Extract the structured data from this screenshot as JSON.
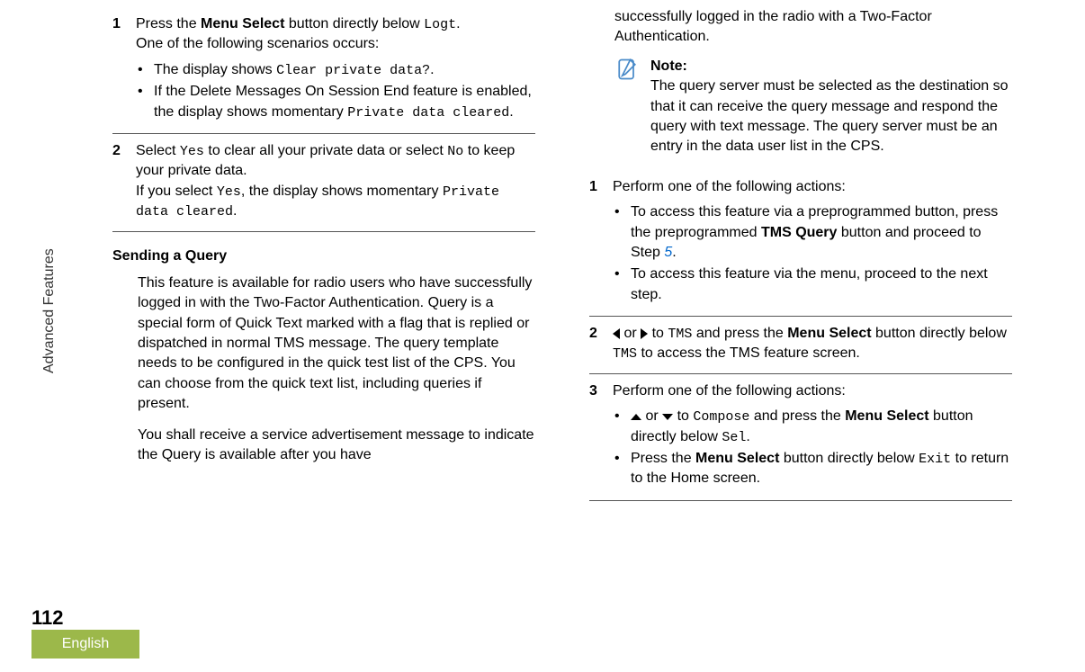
{
  "sideLabel": "Advanced Features",
  "pageNumber": "112",
  "language": "English",
  "leftColumn": {
    "step1": {
      "num": "1",
      "line1a": "Press the ",
      "line1b": "Menu Select",
      "line1c": " button directly below ",
      "line1d": "Logt",
      "line1e": ".",
      "line2": "One of the following scenarios occurs:",
      "bullet1a": "The display shows ",
      "bullet1b": "Clear private data?",
      "bullet1c": ".",
      "bullet2a": "If the Delete Messages On Session End feature is enabled, the display shows momentary ",
      "bullet2b": "Private data cleared",
      "bullet2c": "."
    },
    "step2": {
      "num": "2",
      "line1a": "Select ",
      "line1b": "Yes",
      "line1c": " to clear all your private data or select ",
      "line1d": "No",
      "line1e": " to keep your private data.",
      "line2a": "If you select ",
      "line2b": "Yes",
      "line2c": ", the display shows momentary ",
      "line2d": "Private data cleared",
      "line2e": "."
    },
    "heading": "Sending a Query",
    "para1": "This feature is available for radio users who have successfully logged in with the Two-Factor Authentication. Query is a special form of Quick Text marked with a flag that is replied or dispatched in normal TMS message. The query template needs to be configured in the quick test list of the CPS. You can choose from the quick text list, including queries if present.",
    "para2": "You shall receive a service advertisement message to indicate the Query is available after you have"
  },
  "rightColumn": {
    "contPara": "successfully logged in the radio with a Two-Factor Authentication.",
    "note": {
      "title": "Note:",
      "body": "The query server must be selected as the destination so that it can receive the query message and respond the query with text message. The query server must be an entry in the data user list in the CPS."
    },
    "step1": {
      "num": "1",
      "line1": "Perform one of the following actions:",
      "bullet1a": "To access this feature via a preprogrammed button, press the preprogrammed ",
      "bullet1b": "TMS Query",
      "bullet1c": " button and proceed to Step ",
      "bullet1d": "5",
      "bullet1e": ".",
      "bullet2": "To access this feature via the menu, proceed to the next step."
    },
    "step2": {
      "num": "2",
      "line1a": " or ",
      "line1b": " to ",
      "line1c": "TMS",
      "line1d": " and press the ",
      "line1e": "Menu Select",
      "line1f": " button directly below ",
      "line1g": "TMS",
      "line1h": " to access the TMS feature screen."
    },
    "step3": {
      "num": "3",
      "line1": "Perform one of the following actions:",
      "bullet1a": " or ",
      "bullet1b": " to ",
      "bullet1c": "Compose",
      "bullet1d": " and press the ",
      "bullet1e": "Menu Select",
      "bullet1f": " button directly below ",
      "bullet1g": "Sel",
      "bullet1h": ".",
      "bullet2a": "Press the ",
      "bullet2b": "Menu Select",
      "bullet2c": " button directly below ",
      "bullet2d": "Exit",
      "bullet2e": " to return to the Home screen."
    }
  }
}
